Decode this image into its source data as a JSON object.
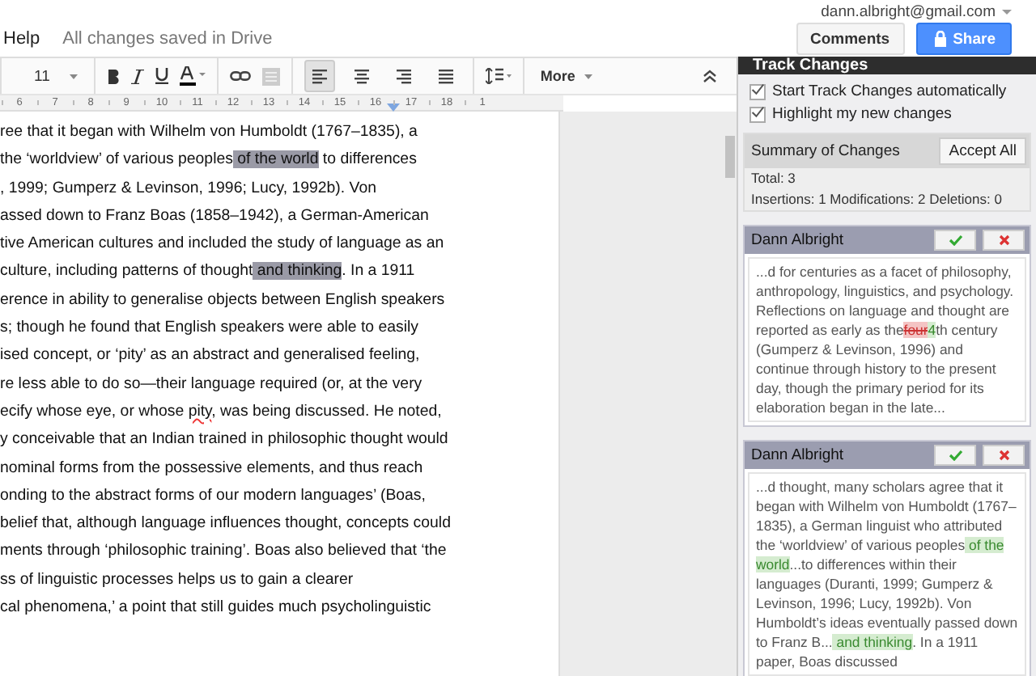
{
  "menu": {
    "items": [
      "Help"
    ],
    "save_status": "All changes saved in Drive"
  },
  "account": {
    "email": "dann.albright@gmail.com"
  },
  "header_buttons": [
    {
      "label": "Comments",
      "kind": "plain"
    },
    {
      "label": "Share",
      "kind": "primary"
    }
  ],
  "toolbar": {
    "font_size": "11",
    "more": "More",
    "alignments": [
      {
        "kind": "left",
        "selected": true
      },
      {
        "kind": "center",
        "selected": false
      },
      {
        "kind": "right",
        "selected": false
      },
      {
        "kind": "justify",
        "selected": false
      }
    ]
  },
  "ruler": [
    "6",
    "7",
    "8",
    "9",
    "10",
    "11",
    "12",
    "13",
    "14",
    "15",
    "16",
    "17",
    "18",
    "1"
  ],
  "document": {
    "lines": [
      [
        {
          "text": "ree that it began with Wilhelm von Humboldt (1767–1835), a",
          "kind": "plain"
        }
      ],
      [
        {
          "text": " the ‘worldview’ of various peoples",
          "kind": "plain"
        },
        {
          "text": " of the world",
          "kind": "highlight"
        },
        {
          "text": " to differences",
          "kind": "plain"
        }
      ],
      [
        {
          "text": ", 1999; Gumperz & Levinson, 1996; Lucy, 1992b).  Von",
          "kind": "plain"
        }
      ],
      [
        {
          "text": "assed down to Franz Boas (1858–1942), a German-American",
          "kind": "plain"
        }
      ],
      [
        {
          "text": "tive American cultures and included the study of language as an",
          "kind": "plain"
        }
      ],
      [
        {
          "text": " culture, including patterns of thought",
          "kind": "plain"
        },
        {
          "text": " and thinking",
          "kind": "highlight"
        },
        {
          "text": ". In a 1911",
          "kind": "plain"
        }
      ],
      [
        {
          "text": "erence in ability to generalise objects between English speakers",
          "kind": "plain"
        }
      ],
      [
        {
          "text": "s; though he found that English speakers were able to easily",
          "kind": "plain"
        }
      ],
      [
        {
          "text": "ised concept, or ‘pity’ as an abstract and generalised feeling,",
          "kind": "plain"
        }
      ],
      [
        {
          "text": "re less able to do so—their language required (or, at the very",
          "kind": "plain"
        }
      ],
      [
        {
          "text": "ecify whose eye, or whose ",
          "kind": "plain"
        },
        {
          "text": "pity",
          "kind": "misspelled"
        },
        {
          "text": ", was being discussed. He noted,",
          "kind": "plain"
        }
      ],
      [
        {
          "text": "y conceivable that an Indian trained in philosophic thought would",
          "kind": "plain"
        }
      ],
      [
        {
          "text": "nominal forms from the possessive elements, and thus reach",
          "kind": "plain"
        }
      ],
      [
        {
          "text": "onding to the abstract forms of our modern languages’ (Boas,",
          "kind": "plain"
        }
      ],
      [
        {
          "text": " belief that, although language influences thought, concepts could",
          "kind": "plain"
        }
      ],
      [
        {
          "text": "ments through ‘philosophic training’. Boas also believed that ‘the",
          "kind": "plain"
        }
      ],
      [
        {
          "text": "ss of linguistic processes helps us to gain a clearer",
          "kind": "plain"
        }
      ],
      [
        {
          "text": "cal phenomena,’ a point that still guides much psycholinguistic",
          "kind": "plain"
        }
      ]
    ]
  },
  "panel": {
    "title": "Track Changes",
    "options": [
      {
        "label": "Start Track Changes automatically",
        "checked": true
      },
      {
        "label": "Highlight my new changes",
        "checked": true
      }
    ],
    "summary": {
      "title": "Summary of Changes",
      "accept_all": "Accept All",
      "total": "Total: 3",
      "counts": "Insertions: 1 Modifications: 2 Deletions: 0"
    },
    "changes": [
      {
        "author": "Dann Albright",
        "segments": [
          {
            "text": "...d for centuries as a facet of philosophy, anthropology, linguistics, and psychology. Reflections on language and thought are reported as early as the",
            "kind": "plain"
          },
          {
            "text": "four",
            "kind": "deleted"
          },
          {
            "text": "4",
            "kind": "inserted"
          },
          {
            "text": "th century (Gumperz & Levinson, 1996) and continue through history to the present day, though the primary period for its elaboration began in the late...",
            "kind": "plain"
          }
        ]
      },
      {
        "author": "Dann Albright",
        "segments": [
          {
            "text": "...d thought, many scholars agree that it began with Wilhelm von Humboldt (1767–1835), a German linguist who attributed the ‘worldview’ of various peoples",
            "kind": "plain"
          },
          {
            "text": " of the world",
            "kind": "inserted"
          },
          {
            "text": "...to differences within their languages (Duranti, 1999; Gumperz & Levinson, 1996; Lucy, 1992b). Von Humboldt’s ideas eventually passed down to Franz B...",
            "kind": "plain"
          },
          {
            "text": " and thinking",
            "kind": "inserted"
          },
          {
            "text": ". In a 1911 paper, Boas discussed",
            "kind": "plain"
          }
        ]
      }
    ]
  }
}
